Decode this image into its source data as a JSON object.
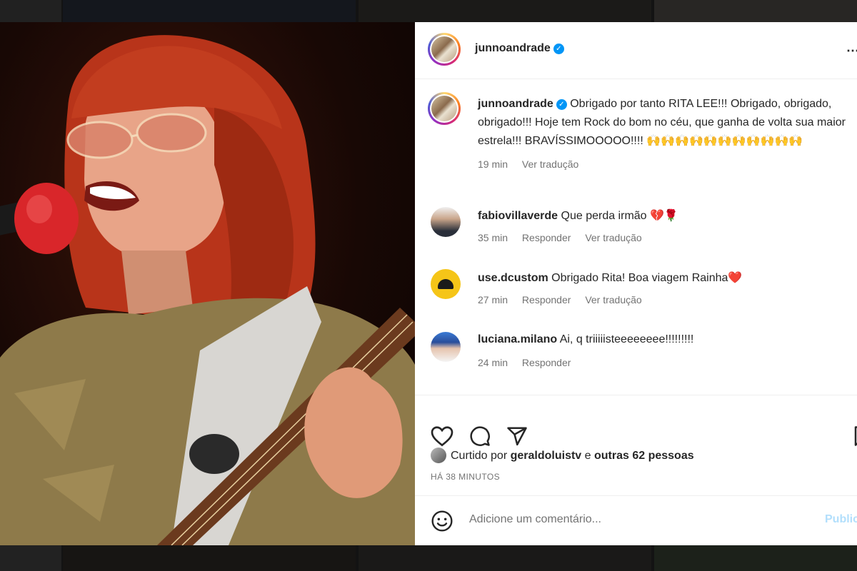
{
  "header": {
    "username": "junnoandrade",
    "verified_icon": "verified-check-icon",
    "more_icon": "more-options-icon"
  },
  "caption": {
    "username": "junnoandrade",
    "text": "Obrigado por tanto RITA LEE!!! Obrigado, obrigado, obrigado!!! Hoje tem Rock do bom no céu, que ganha de volta sua maior estrela!!! BRAVÍSSIMOOOOO!!!! 🙌🙌🙌🙌🙌🙌🙌🙌🙌🙌🙌",
    "time": "19 min",
    "translate": "Ver tradução"
  },
  "comments": [
    {
      "username": "fabiovillaverde",
      "text": "Que perda irmão 💔🌹",
      "time": "35 min",
      "reply": "Responder",
      "translate": "Ver tradução"
    },
    {
      "username": "use.dcustom",
      "text": "Obrigado Rita! Boa viagem Rainha❤️",
      "time": "27 min",
      "reply": "Responder",
      "translate": "Ver tradução"
    },
    {
      "username": "luciana.milano",
      "text": "Ai, q triiiiisteeeeeeee!!!!!!!!!",
      "time": "24 min",
      "reply": "Responder"
    }
  ],
  "actions": {
    "like_icon": "heart-icon",
    "comment_icon": "comment-bubble-icon",
    "share_icon": "send-icon",
    "save_icon": "bookmark-icon"
  },
  "likes": {
    "prefix": "Curtido por",
    "user": "geraldoluistv",
    "connector": "e",
    "others": "outras 62 pessoas"
  },
  "posted": "HÁ 38 MINUTOS",
  "comment_box": {
    "emoji_icon": "emoji-icon",
    "placeholder": "Adicione um comentário...",
    "publish_label": "Publicar"
  },
  "colors": {
    "accent": "#0095f6",
    "publish_disabled": "#b2dffc",
    "text": "#262626",
    "muted": "#737373"
  }
}
